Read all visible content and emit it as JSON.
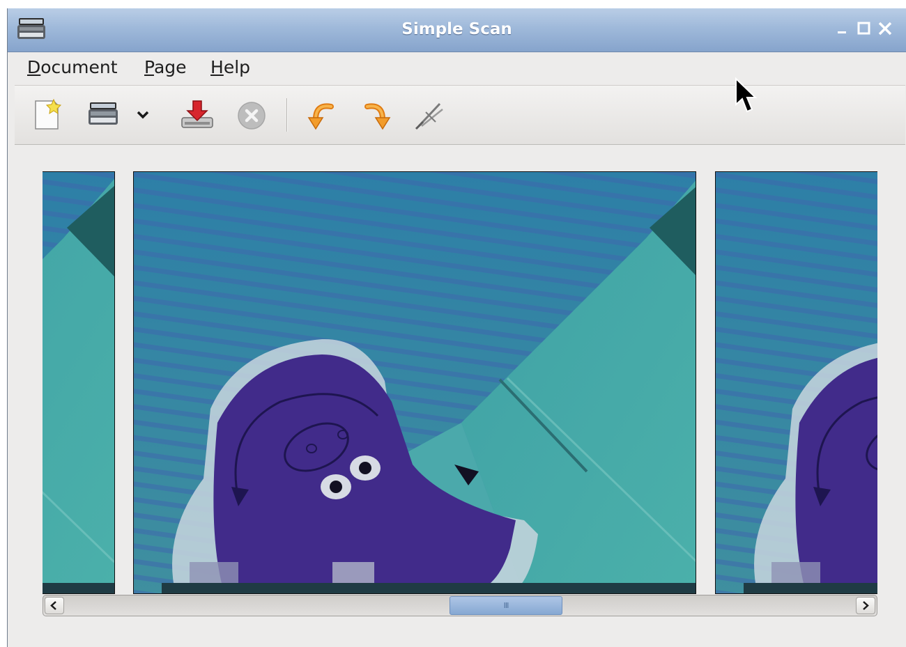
{
  "window": {
    "title": "Simple Scan",
    "app_icon": "scanner-icon",
    "controls": [
      "minimize-icon",
      "maximize-icon",
      "close-icon"
    ]
  },
  "menubar": {
    "items": [
      {
        "mnemonic": "D",
        "rest": "ocument"
      },
      {
        "mnemonic": "P",
        "rest": "age"
      },
      {
        "mnemonic": "H",
        "rest": "elp"
      }
    ]
  },
  "toolbar": {
    "icons": [
      "new-document-icon",
      "scan-icon",
      "scan-options-dropdown-icon",
      "save-icon",
      "stop-icon",
      "rotate-left-icon",
      "rotate-right-icon",
      "crop-icon"
    ]
  },
  "document": {
    "pages": [
      "webcam-page-1",
      "webcam-page-2",
      "webcam-page-3"
    ],
    "selected_page": 2
  },
  "scrollbar": {
    "left_arrow": "scroll-left-icon",
    "right_arrow": "scroll-right-icon",
    "grip": "III"
  },
  "colors": {
    "titlebar": "#9fb9da",
    "window_bg": "#edeceb",
    "scroll_thumb": "#86a8d2"
  }
}
